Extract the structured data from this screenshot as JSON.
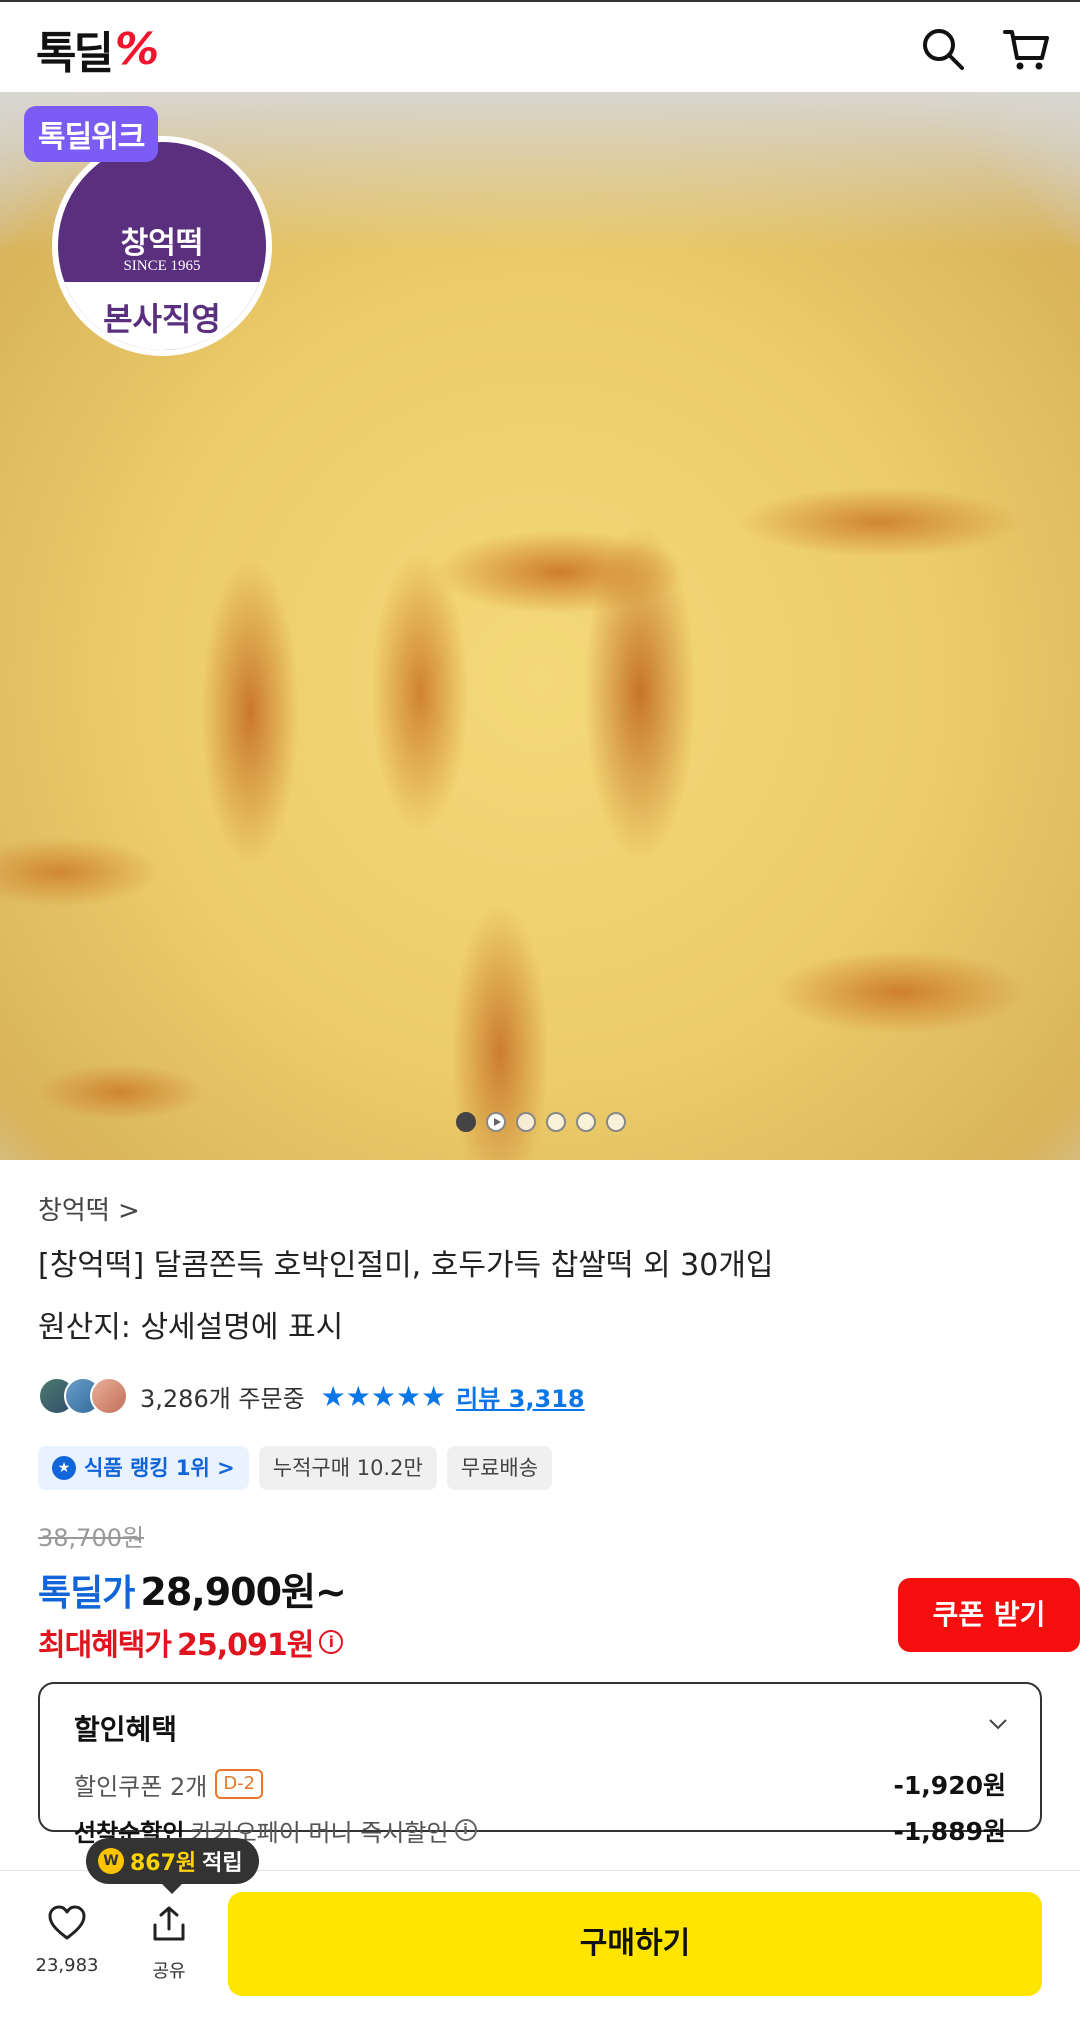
{
  "header": {
    "logo_text": "톡딜",
    "logo_mark": "%",
    "search_icon": "search-icon",
    "cart_icon": "cart-icon"
  },
  "hero": {
    "badge": "톡딜위크",
    "brand_name": "창억떡",
    "brand_since": "SINCE 1965",
    "brand_band": "본사직영",
    "slide_count": 6,
    "active_slide": 1
  },
  "product": {
    "seller": "창억떡 >",
    "title": "[창억떡] 달콤쫀득 호박인절미, 호두가득 찹쌀떡 외 30개입",
    "origin": "원산지: 상세설명에 표시",
    "orders": "3,286개 주문중",
    "rating_stars": 5,
    "review_link": "리뷰 3,318",
    "chips": {
      "ranking": "식품 랭킹 1위 >",
      "cumulative": "누적구매 10.2만",
      "shipping": "무료배송"
    }
  },
  "price": {
    "original": "38,700원",
    "deal_label": "톡딜가",
    "deal_price": "28,900원~",
    "max_label": "최대혜택가",
    "max_price": "25,091원",
    "coupon_button": "쿠폰 받기"
  },
  "benefits": {
    "title": "할인혜택",
    "coupon_label": "할인쿠폰 2개",
    "coupon_badge": "D-2",
    "coupon_amount": "-1,920원",
    "first_label": "선착순할인",
    "first_desc": "카카오페이 머니 즉시할인",
    "first_amount": "-1,889원"
  },
  "bottom": {
    "points_amount": "867원",
    "points_suffix": "적립",
    "like_count": "23,983",
    "share_label": "공유",
    "buy_button": "구매하기"
  },
  "colors": {
    "deal_blue": "#1165d8",
    "max_red": "#e0151f",
    "coupon_red": "#f50f0f",
    "buy_yellow": "#ffe500",
    "badge_purple": "#7b5cf5",
    "brand_purple": "#5a2f7e"
  }
}
